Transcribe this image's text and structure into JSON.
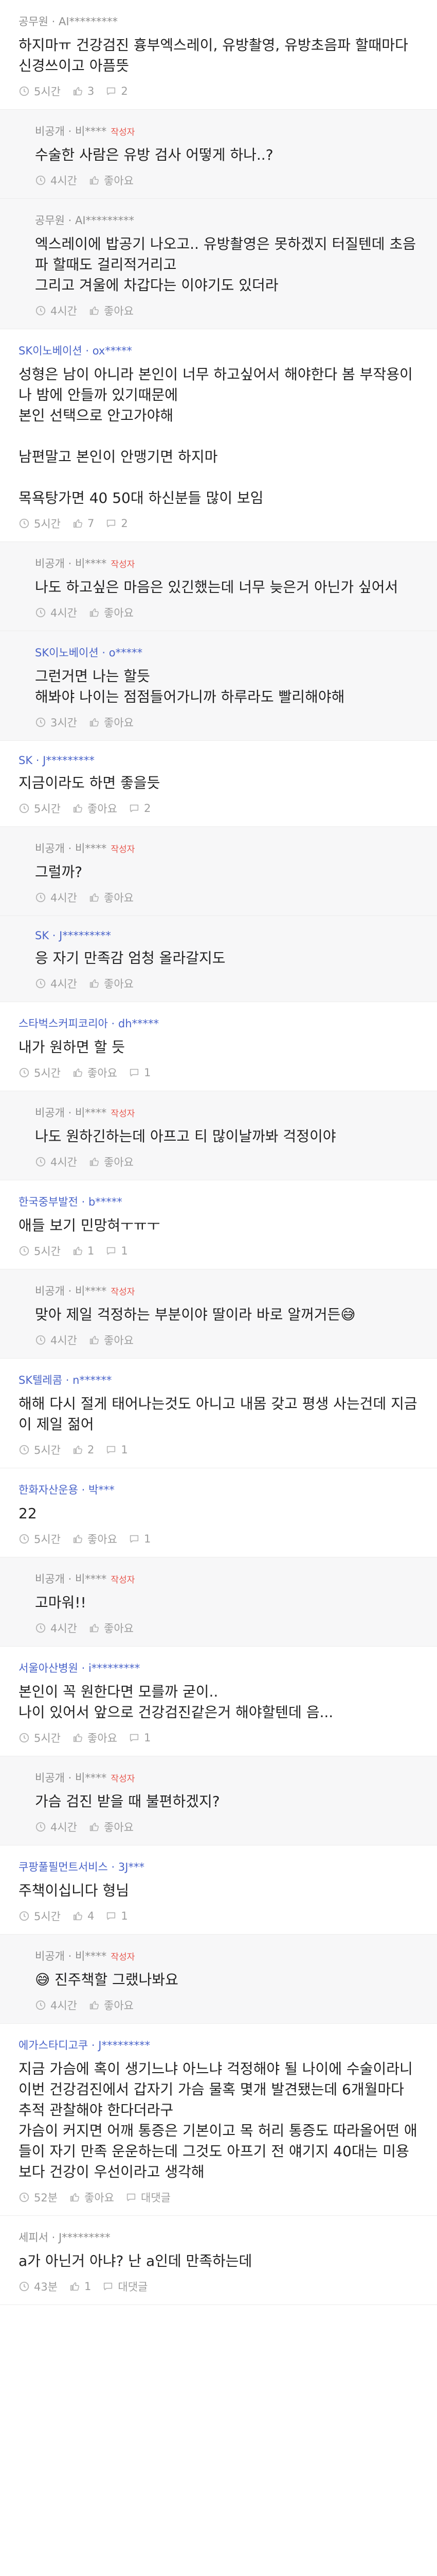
{
  "comments": [
    {
      "author": "공무원 · AI*********",
      "is_author": false,
      "company": false,
      "reply": false,
      "text": "하지마ㅠ 건강검진 흉부엑스레이, 유방촬영, 유방초음파 할때마다 신경쓰이고 아픔뜻",
      "time": "5시간",
      "likes": "3",
      "comments_count": "2"
    },
    {
      "author": "비공개 · 비****",
      "is_author": true,
      "company": false,
      "reply": true,
      "text": "수술한 사람은 유방 검사 어떻게 하나..?",
      "time": "4시간",
      "likes": "좋아요",
      "comments_count": null
    },
    {
      "author": "공무원 · AI*********",
      "is_author": false,
      "company": false,
      "reply": true,
      "text": "엑스레이에 밥공기 나오고.. 유방촬영은 못하겠지 터질텐데 초음파 할때도 걸리적거리고\n그리고 겨울에 차갑다는 이야기도 있더라",
      "time": "4시간",
      "likes": "좋아요",
      "comments_count": null
    },
    {
      "author": "SK이노베이션 · ox*****",
      "is_author": false,
      "company": true,
      "reply": false,
      "text": "성형은 남이 아니라 본인이 너무 하고싶어서 해야한다 봄 부작용이나 밤에 안들까 있기때문에\n본인 선택으로 안고가야해\n\n남편말고 본인이 안맹기면 하지마\n\n목욕탕가면 40 50대 하신분들 많이 보임",
      "time": "5시간",
      "likes": "7",
      "comments_count": "2"
    },
    {
      "author": "비공개 · 비****",
      "is_author": true,
      "company": false,
      "reply": true,
      "text": "나도 하고싶은 마음은 있긴했는데 너무 늦은거 아닌가 싶어서",
      "time": "4시간",
      "likes": "좋아요",
      "comments_count": null
    },
    {
      "author": "SK이노베이션 · o*****",
      "is_author": false,
      "company": true,
      "reply": true,
      "text": "그런거면 나는 할듯\n해봐야 나이는 점점들어가니까 하루라도 빨리해야해",
      "time": "3시간",
      "likes": "좋아요",
      "comments_count": null
    },
    {
      "author": "SK · J*********",
      "is_author": false,
      "company": true,
      "reply": false,
      "text": "지금이라도 하면 좋을듯",
      "time": "5시간",
      "likes": "좋아요",
      "comments_count": "2"
    },
    {
      "author": "비공개 · 비****",
      "is_author": true,
      "company": false,
      "reply": true,
      "text": "그럴까?",
      "time": "4시간",
      "likes": "좋아요",
      "comments_count": null
    },
    {
      "author": "SK · J*********",
      "is_author": false,
      "company": true,
      "reply": true,
      "text": "응 자기 만족감 엄청 올라갈지도",
      "time": "4시간",
      "likes": "좋아요",
      "comments_count": null
    },
    {
      "author": "스타벅스커피코리아 · dh*****",
      "is_author": false,
      "company": true,
      "reply": false,
      "text": "내가 원하면 할 듯",
      "time": "5시간",
      "likes": "좋아요",
      "comments_count": "1"
    },
    {
      "author": "비공개 · 비****",
      "is_author": true,
      "company": false,
      "reply": true,
      "text": "나도 원하긴하는데 아프고 티 많이날까봐 걱정이야",
      "time": "4시간",
      "likes": "좋아요",
      "comments_count": null
    },
    {
      "author": "한국중부발전 · b*****",
      "is_author": false,
      "company": true,
      "reply": false,
      "text": "애들 보기 민망혀ㅜㅠㅜ",
      "time": "5시간",
      "likes": "1",
      "comments_count": "1"
    },
    {
      "author": "비공개 · 비****",
      "is_author": true,
      "company": false,
      "reply": true,
      "text": "맞아 제일 걱정하는 부분이야 딸이라 바로 알꺼거든😅",
      "time": "4시간",
      "likes": "좋아요",
      "comments_count": null
    },
    {
      "author": "SK텔레콤 · n******",
      "is_author": false,
      "company": true,
      "reply": false,
      "text": "해해 다시 절게 태어나는것도 아니고 내몸 갖고 평생 사는건데 지금이 제일 젊어",
      "time": "5시간",
      "likes": "2",
      "comments_count": "1"
    },
    {
      "author": "한화자산운용 · 박***",
      "is_author": false,
      "company": true,
      "reply": false,
      "text": "22",
      "time": "5시간",
      "likes": "좋아요",
      "comments_count": "1"
    },
    {
      "author": "비공개 · 비****",
      "is_author": true,
      "company": false,
      "reply": true,
      "text": "고마워!!",
      "time": "4시간",
      "likes": "좋아요",
      "comments_count": null
    },
    {
      "author": "서울아산병원 · i*********",
      "is_author": false,
      "company": true,
      "reply": false,
      "text": "본인이 꼭 원한다면 모를까 굳이..\n나이 있어서 앞으로 건강검진같은거 해야할텐데 음...",
      "time": "5시간",
      "likes": "좋아요",
      "comments_count": "1"
    },
    {
      "author": "비공개 · 비****",
      "is_author": true,
      "company": false,
      "reply": true,
      "text": "가슴 검진 받을 때 불편하겠지?",
      "time": "4시간",
      "likes": "좋아요",
      "comments_count": null
    },
    {
      "author": "쿠팡풀필먼트서비스 · 3J***",
      "is_author": false,
      "company": true,
      "reply": false,
      "text": "주책이십니다 형님",
      "time": "5시간",
      "likes": "4",
      "comments_count": "1"
    },
    {
      "author": "비공개 · 비****",
      "is_author": true,
      "company": false,
      "reply": true,
      "text": "😅 진주책할 그랬나봐요",
      "time": "4시간",
      "likes": "좋아요",
      "comments_count": null
    },
    {
      "author": "에가스타디고쿠 · J*********",
      "is_author": false,
      "company": true,
      "reply": false,
      "text": "지금 가슴에 혹이 생기느냐 아느냐 걱정해야 될 나이에 수술이라니\n이번 건강검진에서 갑자기 가슴 물혹 몇개 발견됐는데 6개월마다 추적 관찰해야 한다더라구\n가슴이 커지면 어깨 통증은 기본이고 목 허리 통증도 따라올어떤 애들이 자기 만족 운운하는데 그것도 아프기 전 얘기지 40대는 미용보다 건강이 우선이라고 생각해",
      "time": "52분",
      "likes": "좋아요",
      "comments_count": "대댓글"
    },
    {
      "author": "세피서 · J*********",
      "is_author": false,
      "company": false,
      "reply": false,
      "text": "a가 아닌거 아냐? 난 a인데 만족하는데",
      "time": "43분",
      "likes": "1",
      "comments_count": "대댓글"
    }
  ],
  "labels": {
    "author_tag": "작성자"
  },
  "colors": {
    "company_name": "#4a64c9",
    "author_tag": "#e8584f",
    "muted": "#9e9e9e",
    "reply_bg": "#f7f7f8"
  }
}
